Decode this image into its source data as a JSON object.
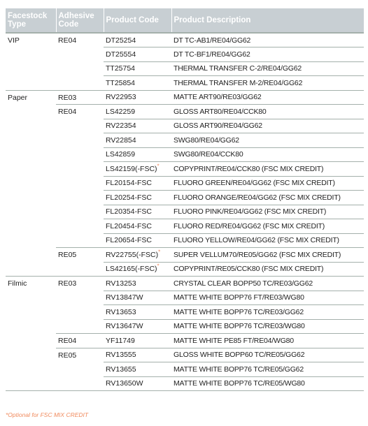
{
  "table": {
    "headers": [
      "Facestock Type",
      "Adhesive Code",
      "Product Code",
      "Product Description"
    ],
    "groups": [
      {
        "facestock": "VIP",
        "adhesives": [
          {
            "code": "RE04",
            "products": [
              {
                "code": "DT25254",
                "optional": false,
                "description": "DT TC-AB1/RE04/GG62"
              },
              {
                "code": "DT25554",
                "optional": false,
                "description": "DT TC-BF1/RE04/GG62"
              },
              {
                "code": "TT25754",
                "optional": false,
                "description": "THERMAL TRANSFER C-2/RE04/GG62"
              },
              {
                "code": "TT25854",
                "optional": false,
                "description": "THERMAL TRANSFER M-2/RE04/GG62"
              }
            ]
          }
        ]
      },
      {
        "facestock": "Paper",
        "adhesives": [
          {
            "code": "RE03",
            "products": [
              {
                "code": "RV22953",
                "optional": false,
                "description": "MATTE ART90/RE03/GG62"
              }
            ]
          },
          {
            "code": "RE04",
            "products": [
              {
                "code": "LS42259",
                "optional": false,
                "description": "GLOSS ART80/RE04/CCK80"
              },
              {
                "code": "RV22354",
                "optional": false,
                "description": "GLOSS ART90/RE04/GG62"
              },
              {
                "code": "RV22854",
                "optional": false,
                "description": "SWG80/RE04/GG62"
              },
              {
                "code": "LS42859",
                "optional": false,
                "description": "SWG80/RE04/CCK80"
              },
              {
                "code": "LS42159(-FSC)",
                "optional": true,
                "description": "COPYPRINT/RE04/CCK80 (FSC MIX CREDIT)"
              },
              {
                "code": "FL20154-FSC",
                "optional": false,
                "description": "FLUORO GREEN/RE04/GG62 (FSC MIX CREDIT)"
              },
              {
                "code": "FL20254-FSC",
                "optional": false,
                "description": "FLUORO ORANGE/RE04/GG62 (FSC MIX CREDIT)"
              },
              {
                "code": "FL20354-FSC",
                "optional": false,
                "description": "FLUORO PINK/RE04/GG62 (FSC MIX CREDIT)"
              },
              {
                "code": "FL20454-FSC",
                "optional": false,
                "description": "FLUORO RED/RE04/GG62 (FSC MIX CREDIT)"
              },
              {
                "code": "FL20654-FSC",
                "optional": false,
                "description": "FLUORO YELLOW/RE04/GG62 (FSC MIX CREDIT)"
              }
            ]
          },
          {
            "code": "RE05",
            "products": [
              {
                "code": "RV22755(-FSC)",
                "optional": true,
                "description": "SUPER VELLUM70/RE05/GG62 (FSC MIX CREDIT)"
              },
              {
                "code": "LS42165(-FSC)",
                "optional": true,
                "description": "COPYPRINT/RE05/CCK80 (FSC MIX CREDIT)"
              }
            ]
          }
        ]
      },
      {
        "facestock": "Filmic",
        "adhesives": [
          {
            "code": "RE03",
            "products": [
              {
                "code": "RV13253",
                "optional": false,
                "description": "CRYSTAL CLEAR BOPP50 TC/RE03/GG62"
              },
              {
                "code": "RV13847W",
                "optional": false,
                "description": "MATTE WHITE BOPP76 FT/RE03/WG80"
              },
              {
                "code": "RV13653",
                "optional": false,
                "description": "MATTE WHITE BOPP76 TC/RE03/GG62"
              },
              {
                "code": "RV13647W",
                "optional": false,
                "description": "MATTE WHITE BOPP76 TC/RE03/WG80"
              }
            ]
          },
          {
            "code": "RE04",
            "products": [
              {
                "code": "YF11749",
                "optional": false,
                "description": "MATTE WHITE PE85 FT/RE04/WG80"
              }
            ]
          },
          {
            "code": "RE05",
            "products": [
              {
                "code": "RV13555",
                "optional": false,
                "description": "GLOSS WHITE BOPP60 TC/RE05/GG62"
              },
              {
                "code": "RV13655",
                "optional": false,
                "description": "MATTE WHITE BOPP76 TC/RE05/GG62"
              },
              {
                "code": "RV13650W",
                "optional": false,
                "description": "MATTE WHITE BOPP76 TC/RE05/WG80"
              }
            ]
          }
        ]
      }
    ],
    "optional_marker": "*"
  },
  "footnote": "*Optional for FSC MIX CREDIT",
  "colors": {
    "header_bg": "#c8cfd3",
    "header_text": "#ffffff",
    "rule": "#a4b0ab",
    "accent": "#f08a5d"
  }
}
